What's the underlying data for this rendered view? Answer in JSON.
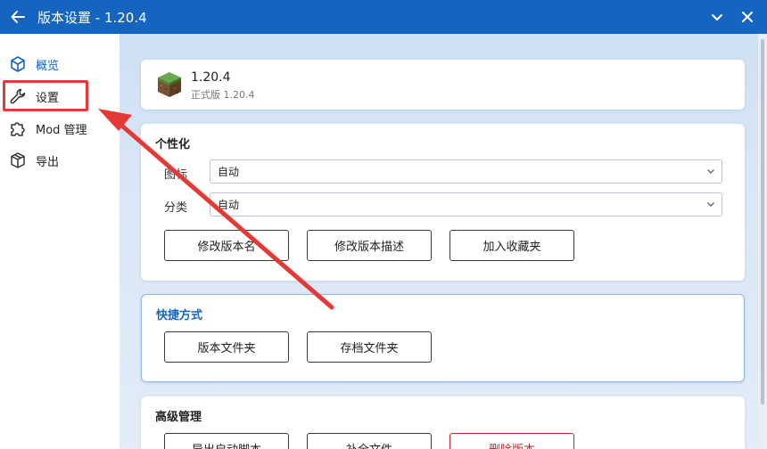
{
  "window": {
    "title": "版本设置 - 1.20.4"
  },
  "sidebar": {
    "items": [
      {
        "label": "概览",
        "icon": "cube-outline-icon"
      },
      {
        "label": "设置",
        "icon": "wrench-icon"
      },
      {
        "label": "Mod 管理",
        "icon": "puzzle-icon"
      },
      {
        "label": "导出",
        "icon": "box-icon"
      }
    ]
  },
  "version_card": {
    "name": "1.20.4",
    "subtitle": "正式版 1.20.4"
  },
  "personalize": {
    "title": "个性化",
    "icon_label": "图标",
    "icon_value": "自动",
    "category_label": "分类",
    "category_value": "自动",
    "buttons": [
      "修改版本名",
      "修改版本描述",
      "加入收藏夹"
    ]
  },
  "shortcuts": {
    "title": "快捷方式",
    "buttons": [
      "版本文件夹",
      "存档文件夹"
    ]
  },
  "advanced": {
    "title": "高级管理",
    "buttons": [
      "导出启动脚本",
      "补全文件",
      "删除版本"
    ]
  },
  "colors": {
    "accent": "#1565c0",
    "highlight": "#e53935",
    "danger": "#c62828"
  }
}
